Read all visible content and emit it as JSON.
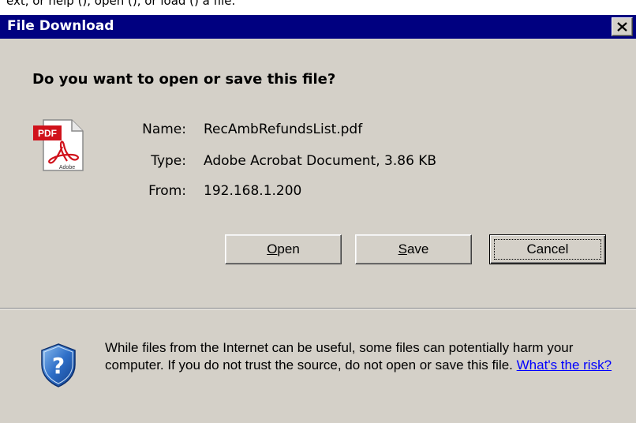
{
  "background_text": "ext, or help (), open (), or load () a file.",
  "dialog": {
    "title": "File Download",
    "question": "Do you want to open or save this file?",
    "file": {
      "icon": "pdf-file-icon",
      "name_label": "Name:",
      "name_value": "RecAmbRefundsList.pdf",
      "type_label": "Type:",
      "type_value": "Adobe Acrobat Document, 3.86 KB",
      "from_label": "From:",
      "from_value": "192.168.1.200"
    },
    "buttons": {
      "open_prefix": "",
      "open_accel": "O",
      "open_rest": "pen",
      "save_accel": "S",
      "save_rest": "ave",
      "cancel_label": "Cancel"
    },
    "warning": {
      "icon": "shield-question-icon",
      "text": "While files from the Internet can be useful, some files can potentially harm your computer. If you do not trust the source, do not open or save this file. ",
      "link": "What's the risk?"
    }
  },
  "colors": {
    "titlebar": "#000080",
    "face": "#d4d0c8",
    "link": "#0000ff"
  }
}
